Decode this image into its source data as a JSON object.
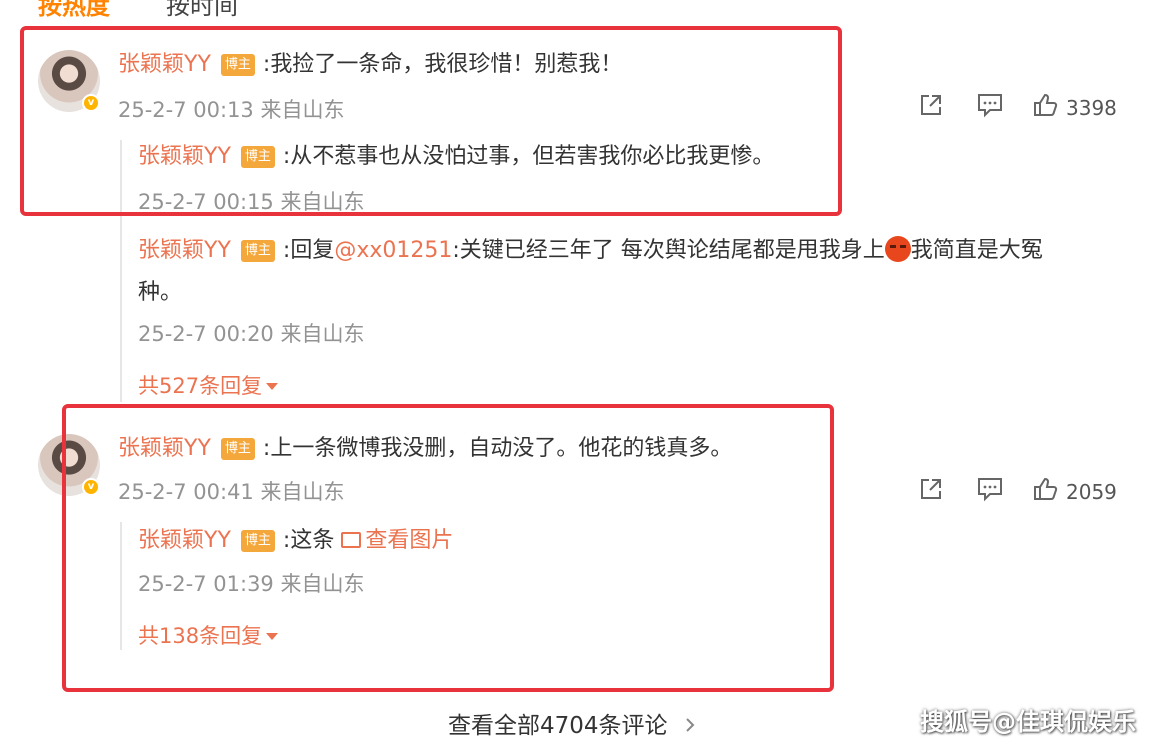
{
  "tabs": [
    "按热度",
    "按时间"
  ],
  "colors": {
    "accent": "#eb7350",
    "highlight_box": "#e8323c",
    "tag_bg": "#f4a73a",
    "meta": "#939393"
  },
  "comments": [
    {
      "user": "张颖颖YY",
      "tag": "博主",
      "text": ":我捡了一条命，我很珍惜！别惹我！",
      "meta": "25-2-7 00:13 来自山东",
      "likes": "3398",
      "replies": [
        {
          "user": "张颖颖YY",
          "tag": "博主",
          "text": ":从不惹事也从没怕过事，但若害我你必比我更惨。",
          "meta": "25-2-7 00:15 来自山东"
        },
        {
          "user": "张颖颖YY",
          "tag": "博主",
          "text_prefix": ":回复",
          "mention": "@xx01251",
          "text": ":关键已经三年了 每次舆论结尾都是甩我身上",
          "text_after_emoji": "我简直是大冤",
          "text_line2": "种。",
          "meta": "25-2-7 00:20 来自山东"
        }
      ],
      "more_replies": "共527条回复"
    },
    {
      "user": "张颖颖YY",
      "tag": "博主",
      "text": ":上一条微博我没删，自动没了。他花的钱真多。",
      "meta": "25-2-7 00:41 来自山东",
      "likes": "2059",
      "replies": [
        {
          "user": "张颖颖YY",
          "tag": "博主",
          "text": ":这条",
          "link": "查看图片",
          "meta": "25-2-7 01:39 来自山东"
        }
      ],
      "more_replies": "共138条回复"
    }
  ],
  "view_all": "查看全部4704条评论",
  "watermark": "搜狐号@佳琪侃娱乐",
  "icons": [
    "share-icon",
    "comment-icon",
    "like-icon",
    "image-icon",
    "chevron-right-icon",
    "verified-badge-icon",
    "angry-emoji-icon"
  ]
}
